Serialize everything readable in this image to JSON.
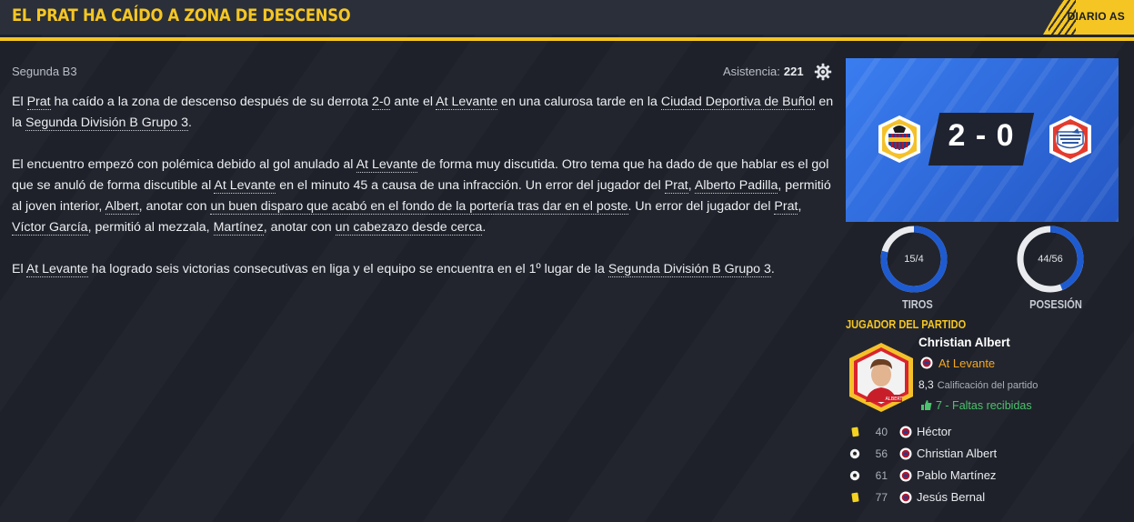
{
  "header": {
    "title": "EL PRAT HA CAÍDO A ZONA DE DESCENSO",
    "source": "DIARIO AS"
  },
  "meta": {
    "competition": "Segunda B3",
    "attendance_label": "Asistencia:",
    "attendance_value": "221"
  },
  "article": {
    "p1": [
      {
        "t": "El "
      },
      {
        "t": "Prat",
        "link": true
      },
      {
        "t": " ha caído a la zona de descenso después de su derrota "
      },
      {
        "t": "2-0",
        "link": true
      },
      {
        "t": " ante el "
      },
      {
        "t": "At Levante",
        "link": true
      },
      {
        "t": " en una calurosa tarde en la "
      },
      {
        "t": "Ciudad Deportiva de Buñol",
        "link": true
      },
      {
        "t": " en la "
      },
      {
        "t": "Segunda División B Grupo 3",
        "link": true
      },
      {
        "t": "."
      }
    ],
    "p2": [
      {
        "t": "El encuentro empezó con polémica debido al gol anulado al "
      },
      {
        "t": "At Levante",
        "link": true
      },
      {
        "t": " de forma muy discutida. Otro tema que ha dado de que hablar es el gol que se anuló de forma discutible al "
      },
      {
        "t": "At Levante",
        "link": true
      },
      {
        "t": " en el minuto 45 a causa de una infracción. Un error del jugador del "
      },
      {
        "t": "Prat",
        "link": true
      },
      {
        "t": ", "
      },
      {
        "t": "Alberto Padilla",
        "link": true
      },
      {
        "t": ", permitió al joven interior, "
      },
      {
        "t": "Albert",
        "link": true
      },
      {
        "t": ", anotar con "
      },
      {
        "t": "un buen disparo que acabó en el fondo de la portería tras dar en el poste",
        "link": true
      },
      {
        "t": ". Un error del jugador del "
      },
      {
        "t": "Prat",
        "link": true
      },
      {
        "t": ", "
      },
      {
        "t": "Víctor García",
        "link": true
      },
      {
        "t": ", permitió al mezzala, "
      },
      {
        "t": "Martínez",
        "link": true
      },
      {
        "t": ", anotar con "
      },
      {
        "t": "un cabezazo desde cerca",
        "link": true
      },
      {
        "t": "."
      }
    ],
    "p3": [
      {
        "t": "El "
      },
      {
        "t": "At Levante",
        "link": true
      },
      {
        "t": " ha logrado seis victorias consecutivas en liga y el equipo se encuentra en el 1º lugar de la "
      },
      {
        "t": "Segunda División B Grupo 3",
        "link": true
      },
      {
        "t": "."
      }
    ]
  },
  "score": {
    "text": "2 - 0",
    "home_crest": "levante-crest",
    "away_crest": "prat-crest"
  },
  "stats": {
    "shots": {
      "value": "15/4",
      "label": "TIROS",
      "fraction": 0.79
    },
    "possession": {
      "value": "44/56",
      "label": "POSESIÓN",
      "fraction": 0.44
    }
  },
  "motm": {
    "title": "JUGADOR DEL PARTIDO",
    "name": "Christian Albert",
    "team": "At Levante",
    "rating": "8,3",
    "rating_label": "Calificación del partido",
    "fouls": "7 - Faltas recibidas",
    "portrait_caption": "ALBERT"
  },
  "events": [
    {
      "type": "yellow-card",
      "minute": "40",
      "player": "Héctor"
    },
    {
      "type": "goal",
      "minute": "56",
      "player": "Christian Albert"
    },
    {
      "type": "goal",
      "minute": "61",
      "player": "Pablo Martínez"
    },
    {
      "type": "yellow-card",
      "minute": "77",
      "player": "Jesús Bernal"
    }
  ],
  "colors": {
    "accent": "#f5c623",
    "background": "#1e2129",
    "panel_blue": "#2a66d6",
    "ring_blue": "#1f5bd0",
    "positive": "#4cc26d"
  }
}
